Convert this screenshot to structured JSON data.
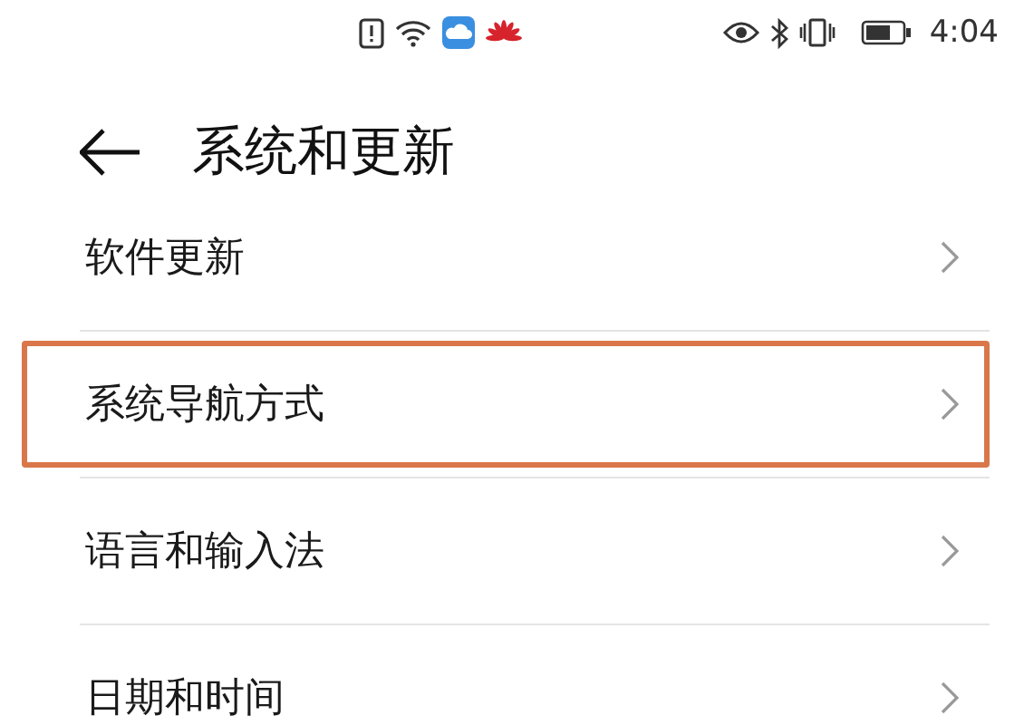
{
  "status_bar": {
    "time": "4:04"
  },
  "header": {
    "title": "系统和更新"
  },
  "items": [
    {
      "label": "软件更新",
      "highlighted": false
    },
    {
      "label": "系统导航方式",
      "highlighted": true
    },
    {
      "label": "语言和输入法",
      "highlighted": false
    },
    {
      "label": "日期和时间",
      "highlighted": false
    }
  ]
}
